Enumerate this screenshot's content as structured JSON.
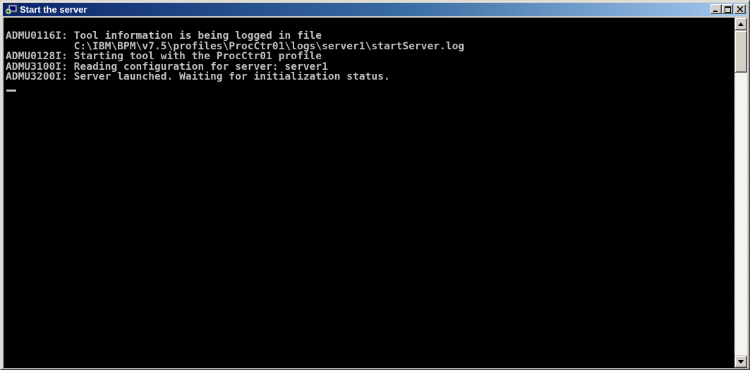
{
  "window": {
    "title": "Start the server",
    "icon": "console-run-icon"
  },
  "title_buttons": {
    "minimize": "minimize-icon",
    "maximize": "maximize-icon",
    "close": "close-icon"
  },
  "console": {
    "lines": [
      "ADMU0116I: Tool information is being logged in file",
      "           C:\\IBM\\BPM\\v7.5\\profiles\\ProcCtr01\\logs\\server1\\startServer.log",
      "ADMU0128I: Starting tool with the ProcCtr01 profile",
      "ADMU3100I: Reading configuration for server: server1",
      "ADMU3200I: Server launched. Waiting for initialization status."
    ],
    "text_color": "#c0c0c0",
    "background": "#000000"
  },
  "colors": {
    "titlebar_start": "#0a246a",
    "titlebar_end": "#a6caf0",
    "chrome": "#d4d0c8"
  }
}
